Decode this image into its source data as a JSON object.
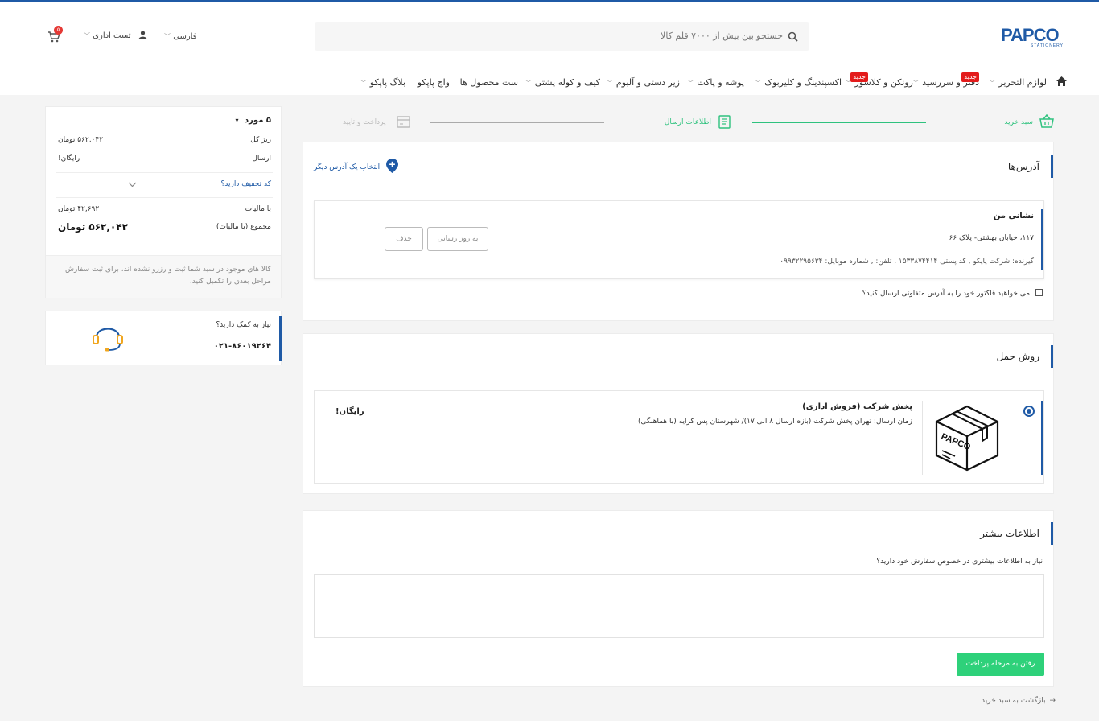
{
  "header": {
    "logo_text": "PAPCO",
    "logo_sub": "STATIONERY",
    "search_placeholder": "جستجو بین بیش از ۷۰۰۰ قلم کالا",
    "language": "فارسی",
    "user_name": "تست اداری",
    "cart_count": "۵"
  },
  "nav": {
    "items": [
      {
        "label": "لوازم التحریر",
        "has_chevron": true,
        "badge": ""
      },
      {
        "label": "دفتر و سررسید",
        "has_chevron": true,
        "badge": "جدید"
      },
      {
        "label": "زونکن و کلاسور",
        "has_chevron": true,
        "badge": "جدید"
      },
      {
        "label": "اکسپندینگ و کلیربوک",
        "has_chevron": true,
        "badge": ""
      },
      {
        "label": "پوشه و پاکت",
        "has_chevron": true,
        "badge": ""
      },
      {
        "label": "زیر دستی و آلبوم",
        "has_chevron": true,
        "badge": ""
      },
      {
        "label": "کیف و کوله پشتی",
        "has_chevron": true,
        "badge": ""
      },
      {
        "label": "ست محصول ها",
        "has_chevron": false,
        "badge": ""
      },
      {
        "label": "واچ پاپکو",
        "has_chevron": false,
        "badge": ""
      },
      {
        "label": "بلاگ پاپکو",
        "has_chevron": true,
        "badge": ""
      }
    ]
  },
  "steps": {
    "cart": "سبد خرید",
    "shipping_info": "اطلاعات ارسال",
    "payment": "پرداخت و تایید"
  },
  "addresses": {
    "title": "آدرس‌ها",
    "add_other": "انتخاب یک آدرس دیگر",
    "name": "نشانی من",
    "address_line": "۱۱۷، خیابان بهشتی- پلاک ۶۶",
    "receiver_line": "گیرنده: شرکت پاپکو , کد پستی ۱۵۳۳۸۷۴۴۱۴ , تلفن: , شماره موبایل: ۰۹۹۳۲۲۹۵۶۳۴",
    "update_button": "به روز رسانی",
    "delete_button": "حذف",
    "different_invoice_label": "می خواهید فاکتور خود را به آدرس متفاوتی ارسال کنید؟"
  },
  "shipping": {
    "title": "روش حمل",
    "method_name": "پخش شرکت (فروش اداری)",
    "method_desc": "زمان ارسال: تهران پخش شرکت (بازه ارسال ۸ الی ۱۷)/ شهرستان پس کرایه (با هماهنگی)",
    "price": "رایگان!",
    "box_logo": "PAPCO"
  },
  "more_info": {
    "title": "اطلاعات بیشتر",
    "question": "نیاز به اطلاعات بیشتری در خصوص سفارش خود دارید؟",
    "textarea_value": "",
    "next_button": "رفتن به مرحله پرداخت",
    "back_link": "بازگشت به سبد خرید"
  },
  "summary": {
    "item_count": "۵ مورد",
    "subtotal_label": "ریز کل",
    "subtotal_value": "۵۶۲,۰۴۲ تومان",
    "shipping_label": "ارسال",
    "shipping_value": "رایگان!",
    "discount_prompt": "کد تخفیف دارید؟",
    "tax_label": "با مالیات",
    "tax_value": "۴۲,۶۹۲ تومان",
    "total_label": "مجموع (با مالیات)",
    "total_value": "۵۶۲,۰۴۲ تومان",
    "note": "کالا های موجود در سبد شما ثبت و رزرو نشده اند، برای ثبت سفارش مراحل بعدی را تکمیل کنید."
  },
  "help": {
    "question": "نیاز به کمک دارید؟",
    "phone": "۰۲۱-۸۶۰۱۹۲۶۴"
  },
  "colors": {
    "primary": "#1f5aa6",
    "green": "#2ed17a",
    "badge_red": "#e31b1b"
  }
}
